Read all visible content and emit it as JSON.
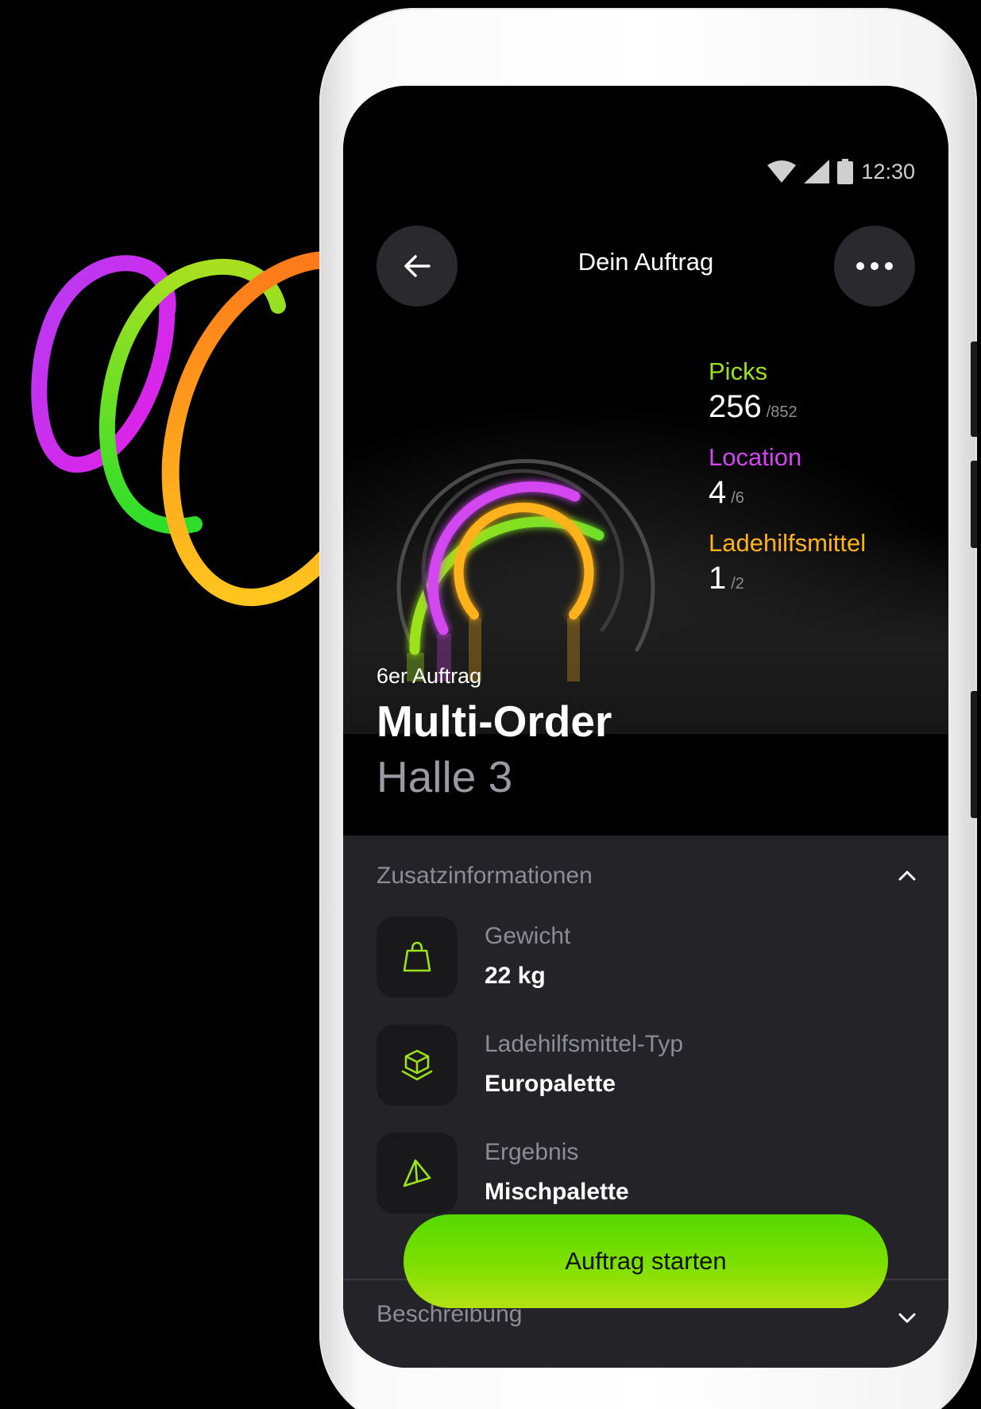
{
  "status_bar": {
    "time": "12:30"
  },
  "header": {
    "title": "Dein Auftrag"
  },
  "stats": [
    {
      "label": "Picks",
      "value": "256",
      "total": "/852",
      "color": "#9be21a"
    },
    {
      "label": "Location",
      "value": "4",
      "total": "/6",
      "color": "#d246f0"
    },
    {
      "label": "Ladehilfsmittel",
      "value": "1",
      "total": "/2",
      "color": "#ffb21a"
    }
  ],
  "progress": {
    "picks": 0.3,
    "location": 0.67,
    "ladehilfsmittel": 0.5
  },
  "order": {
    "type": "6er Auftrag",
    "name": "Multi-Order",
    "hall": "Halle 3"
  },
  "additional_info": {
    "title": "Zusatzinformationen",
    "items": [
      {
        "label": "Gewicht",
        "value": "22 kg",
        "icon": "weight-icon"
      },
      {
        "label": "Ladehilfsmittel-Typ",
        "value": "Europalette",
        "icon": "box-icon"
      },
      {
        "label": "Ergebnis",
        "value": "Mischpalette",
        "icon": "pallet-icon"
      }
    ]
  },
  "description": {
    "title": "Beschreibung"
  },
  "cta": {
    "label": "Auftrag starten"
  },
  "colors": {
    "accent_green": "#7fe000",
    "accent_purple": "#d246f0",
    "accent_orange": "#ffb21a",
    "panel": "#232328"
  }
}
